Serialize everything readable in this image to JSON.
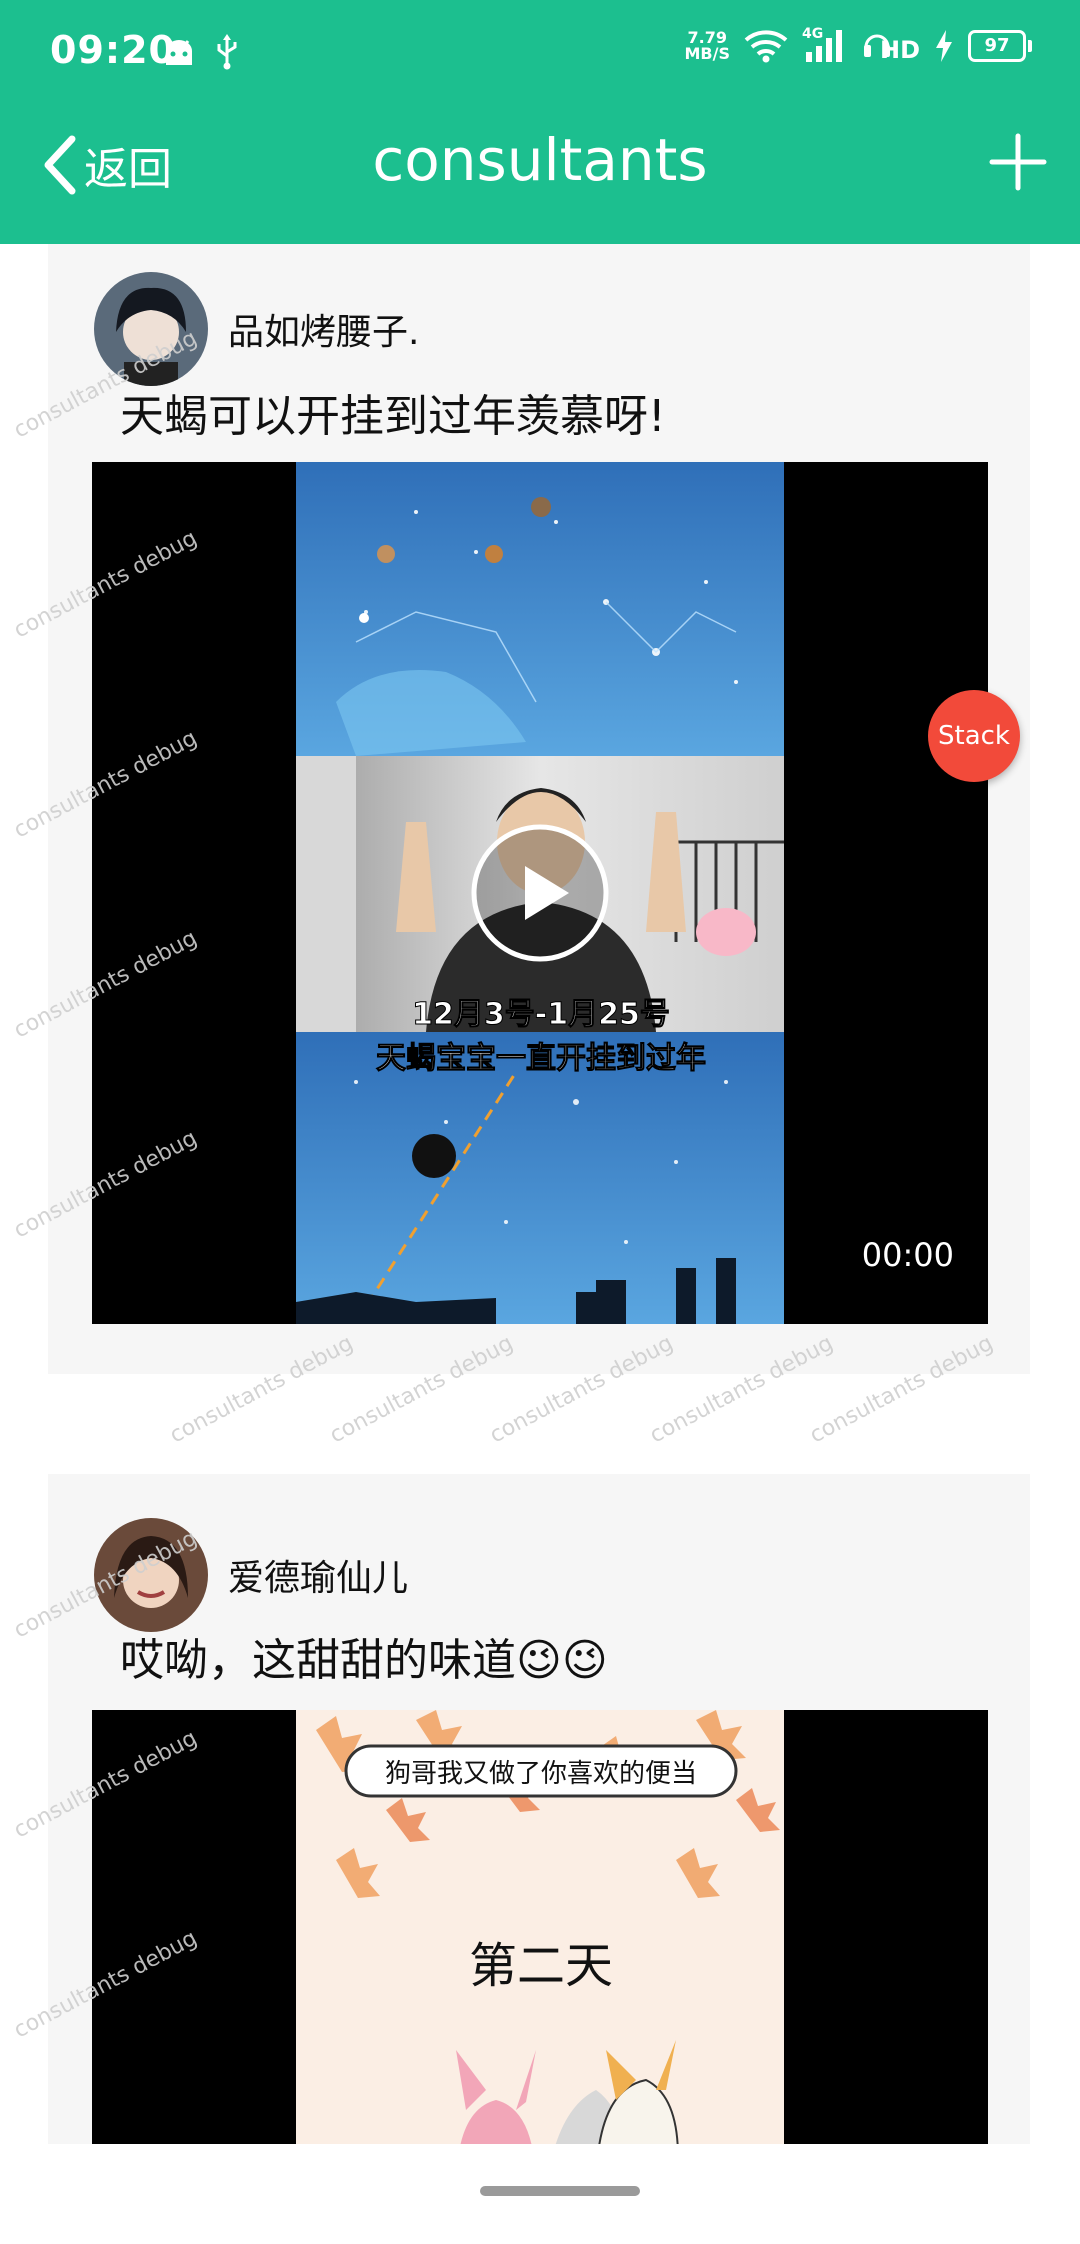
{
  "status_bar": {
    "time": "09:20",
    "net_speed_top": "7.79",
    "net_speed_bottom": "MB/S",
    "signal_label": "4G",
    "hd_label": "HD",
    "battery": "97"
  },
  "app_bar": {
    "back_label": "返回",
    "title": "consultants",
    "color": "#1cbf8f"
  },
  "posts": [
    {
      "username": "品如烤腰子.",
      "text": "天蝎可以开挂到过年羡慕呀!",
      "video": {
        "subtitle_line1": "12月3号-1月25号",
        "subtitle_line2": "天蝎宝宝一直开挂到过年",
        "duration": "00:00"
      }
    },
    {
      "username": "爱德瑜仙儿",
      "text": "哎呦，这甜甜的味道😉😉",
      "video": {
        "bubble_text": "狗哥我又做了你喜欢的便当",
        "center_text": "第二天"
      }
    }
  ],
  "floating_button": {
    "label": "Stack",
    "color": "#f24a3a"
  },
  "watermark_text": "consultants debug"
}
